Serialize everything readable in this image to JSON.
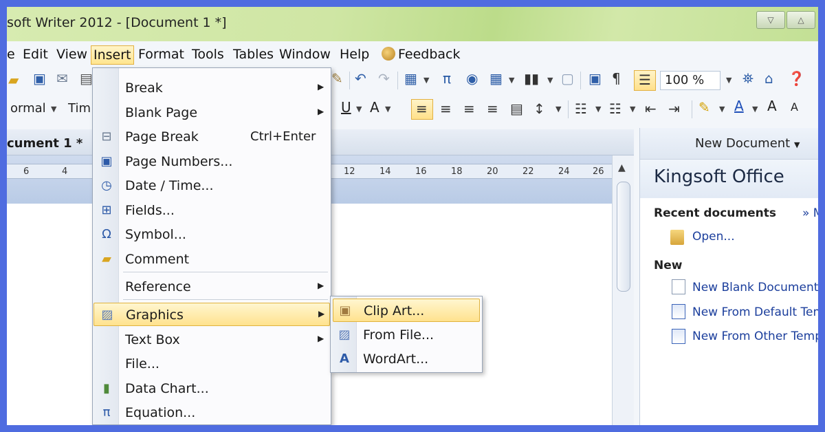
{
  "window": {
    "title": "soft Writer 2012 - [Document 1 *]",
    "minimize_icon": "▽",
    "restore_icon": "△"
  },
  "menubar": {
    "items": [
      "e",
      "Edit",
      "View",
      "Insert",
      "Format",
      "Tools",
      "Tables",
      "Window",
      "Help"
    ],
    "feedback": "Feedback",
    "active": "Insert"
  },
  "toolbar": {
    "zoom": "100 %",
    "style": "ormal",
    "font": "Tim"
  },
  "document": {
    "tab_name": "cument 1 *",
    "ruler_ticks": [
      "6",
      "4",
      "12",
      "14",
      "16",
      "18",
      "20",
      "22",
      "24",
      "26"
    ]
  },
  "insert_menu": {
    "items": [
      {
        "label": "Break",
        "submenu": true,
        "icon": "none"
      },
      {
        "label": "Blank Page",
        "submenu": true,
        "icon": "none"
      },
      {
        "label": "Page Break",
        "shortcut": "Ctrl+Enter",
        "icon": "page-break-icon"
      },
      {
        "label": "Page Numbers...",
        "icon": "page-numbers-icon"
      },
      {
        "label": "Date / Time...",
        "icon": "date-time-icon"
      },
      {
        "label": "Fields...",
        "icon": "fields-icon"
      },
      {
        "label": "Symbol...",
        "icon": "omega-icon"
      },
      {
        "label": "Comment",
        "icon": "comment-icon"
      },
      {
        "label": "Reference",
        "submenu": true,
        "icon": "none"
      },
      {
        "label": "Graphics",
        "submenu": true,
        "icon": "graphics-icon",
        "highlighted": true
      },
      {
        "label": "Text Box",
        "submenu": true,
        "icon": "none"
      },
      {
        "label": "File...",
        "icon": "none"
      },
      {
        "label": "Data Chart...",
        "icon": "bar-chart-icon"
      },
      {
        "label": "Equation...",
        "icon": "pi-icon"
      }
    ]
  },
  "graphics_submenu": {
    "items": [
      {
        "label": "Clip Art...",
        "icon": "clip-art-icon",
        "highlighted": true
      },
      {
        "label": "From File...",
        "icon": "picture-icon"
      },
      {
        "label": "WordArt...",
        "icon": "wordart-icon"
      }
    ]
  },
  "task_pane": {
    "header": "New Document",
    "brand": "Kingsoft Office",
    "recent_title": "Recent documents",
    "more": "» M",
    "open": "Open...",
    "new_title": "New",
    "new_blank": "New Blank Document",
    "new_default": "New From Default Tem",
    "new_other": "New From Other Temp"
  }
}
